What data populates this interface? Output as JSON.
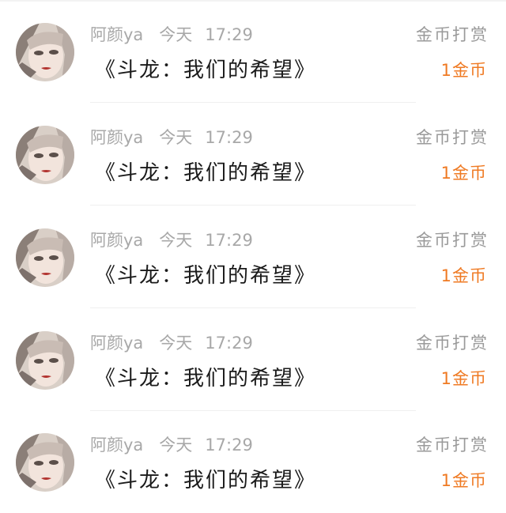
{
  "comments": [
    {
      "author": "阿颜ya",
      "day": "今天",
      "time": "17:29",
      "book_title": "《斗龙：我们的希望》",
      "reward_label": "金币打赏",
      "reward_amount": "1金币"
    },
    {
      "author": "阿颜ya",
      "day": "今天",
      "time": "17:29",
      "book_title": "《斗龙：我们的希望》",
      "reward_label": "金币打赏",
      "reward_amount": "1金币"
    },
    {
      "author": "阿颜ya",
      "day": "今天",
      "time": "17:29",
      "book_title": "《斗龙：我们的希望》",
      "reward_label": "金币打赏",
      "reward_amount": "1金币"
    },
    {
      "author": "阿颜ya",
      "day": "今天",
      "time": "17:29",
      "book_title": "《斗龙：我们的希望》",
      "reward_label": "金币打赏",
      "reward_amount": "1金币"
    },
    {
      "author": "阿颜ya",
      "day": "今天",
      "time": "17:29",
      "book_title": "《斗龙：我们的希望》",
      "reward_label": "金币打赏",
      "reward_amount": "1金币"
    }
  ],
  "colors": {
    "meta_text": "#a8a8a8",
    "title_text": "#1a1a1a",
    "reward_label": "#9a9a9a",
    "reward_amount": "#ef7a23"
  },
  "icons": {
    "avatar": "user-avatar-portrait"
  }
}
